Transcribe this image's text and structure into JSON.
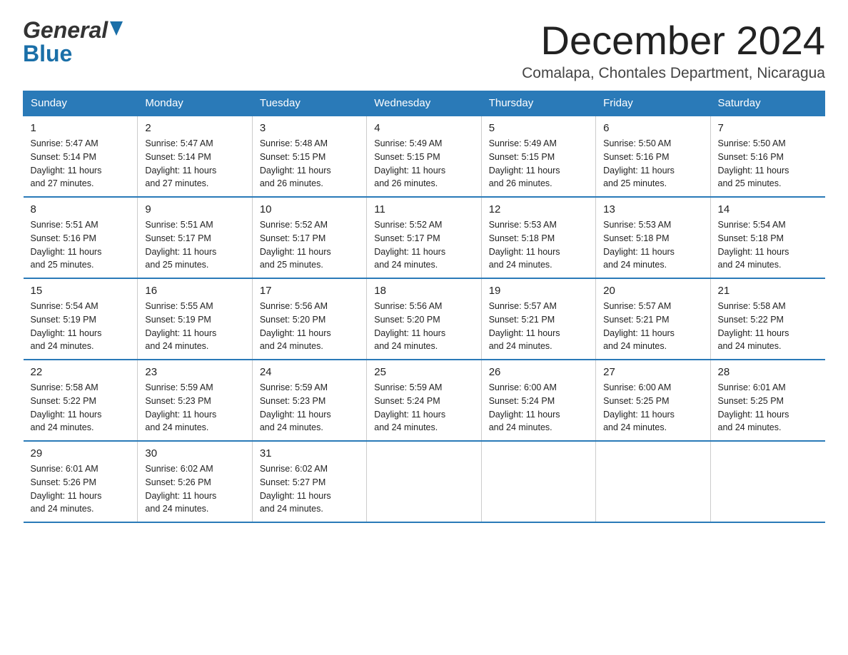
{
  "header": {
    "month_title": "December 2024",
    "location": "Comalapa, Chontales Department, Nicaragua",
    "logo_general": "General",
    "logo_blue": "Blue"
  },
  "weekdays": [
    "Sunday",
    "Monday",
    "Tuesday",
    "Wednesday",
    "Thursday",
    "Friday",
    "Saturday"
  ],
  "weeks": [
    [
      {
        "day": "1",
        "info": "Sunrise: 5:47 AM\nSunset: 5:14 PM\nDaylight: 11 hours\nand 27 minutes."
      },
      {
        "day": "2",
        "info": "Sunrise: 5:47 AM\nSunset: 5:14 PM\nDaylight: 11 hours\nand 27 minutes."
      },
      {
        "day": "3",
        "info": "Sunrise: 5:48 AM\nSunset: 5:15 PM\nDaylight: 11 hours\nand 26 minutes."
      },
      {
        "day": "4",
        "info": "Sunrise: 5:49 AM\nSunset: 5:15 PM\nDaylight: 11 hours\nand 26 minutes."
      },
      {
        "day": "5",
        "info": "Sunrise: 5:49 AM\nSunset: 5:15 PM\nDaylight: 11 hours\nand 26 minutes."
      },
      {
        "day": "6",
        "info": "Sunrise: 5:50 AM\nSunset: 5:16 PM\nDaylight: 11 hours\nand 25 minutes."
      },
      {
        "day": "7",
        "info": "Sunrise: 5:50 AM\nSunset: 5:16 PM\nDaylight: 11 hours\nand 25 minutes."
      }
    ],
    [
      {
        "day": "8",
        "info": "Sunrise: 5:51 AM\nSunset: 5:16 PM\nDaylight: 11 hours\nand 25 minutes."
      },
      {
        "day": "9",
        "info": "Sunrise: 5:51 AM\nSunset: 5:17 PM\nDaylight: 11 hours\nand 25 minutes."
      },
      {
        "day": "10",
        "info": "Sunrise: 5:52 AM\nSunset: 5:17 PM\nDaylight: 11 hours\nand 25 minutes."
      },
      {
        "day": "11",
        "info": "Sunrise: 5:52 AM\nSunset: 5:17 PM\nDaylight: 11 hours\nand 24 minutes."
      },
      {
        "day": "12",
        "info": "Sunrise: 5:53 AM\nSunset: 5:18 PM\nDaylight: 11 hours\nand 24 minutes."
      },
      {
        "day": "13",
        "info": "Sunrise: 5:53 AM\nSunset: 5:18 PM\nDaylight: 11 hours\nand 24 minutes."
      },
      {
        "day": "14",
        "info": "Sunrise: 5:54 AM\nSunset: 5:18 PM\nDaylight: 11 hours\nand 24 minutes."
      }
    ],
    [
      {
        "day": "15",
        "info": "Sunrise: 5:54 AM\nSunset: 5:19 PM\nDaylight: 11 hours\nand 24 minutes."
      },
      {
        "day": "16",
        "info": "Sunrise: 5:55 AM\nSunset: 5:19 PM\nDaylight: 11 hours\nand 24 minutes."
      },
      {
        "day": "17",
        "info": "Sunrise: 5:56 AM\nSunset: 5:20 PM\nDaylight: 11 hours\nand 24 minutes."
      },
      {
        "day": "18",
        "info": "Sunrise: 5:56 AM\nSunset: 5:20 PM\nDaylight: 11 hours\nand 24 minutes."
      },
      {
        "day": "19",
        "info": "Sunrise: 5:57 AM\nSunset: 5:21 PM\nDaylight: 11 hours\nand 24 minutes."
      },
      {
        "day": "20",
        "info": "Sunrise: 5:57 AM\nSunset: 5:21 PM\nDaylight: 11 hours\nand 24 minutes."
      },
      {
        "day": "21",
        "info": "Sunrise: 5:58 AM\nSunset: 5:22 PM\nDaylight: 11 hours\nand 24 minutes."
      }
    ],
    [
      {
        "day": "22",
        "info": "Sunrise: 5:58 AM\nSunset: 5:22 PM\nDaylight: 11 hours\nand 24 minutes."
      },
      {
        "day": "23",
        "info": "Sunrise: 5:59 AM\nSunset: 5:23 PM\nDaylight: 11 hours\nand 24 minutes."
      },
      {
        "day": "24",
        "info": "Sunrise: 5:59 AM\nSunset: 5:23 PM\nDaylight: 11 hours\nand 24 minutes."
      },
      {
        "day": "25",
        "info": "Sunrise: 5:59 AM\nSunset: 5:24 PM\nDaylight: 11 hours\nand 24 minutes."
      },
      {
        "day": "26",
        "info": "Sunrise: 6:00 AM\nSunset: 5:24 PM\nDaylight: 11 hours\nand 24 minutes."
      },
      {
        "day": "27",
        "info": "Sunrise: 6:00 AM\nSunset: 5:25 PM\nDaylight: 11 hours\nand 24 minutes."
      },
      {
        "day": "28",
        "info": "Sunrise: 6:01 AM\nSunset: 5:25 PM\nDaylight: 11 hours\nand 24 minutes."
      }
    ],
    [
      {
        "day": "29",
        "info": "Sunrise: 6:01 AM\nSunset: 5:26 PM\nDaylight: 11 hours\nand 24 minutes."
      },
      {
        "day": "30",
        "info": "Sunrise: 6:02 AM\nSunset: 5:26 PM\nDaylight: 11 hours\nand 24 minutes."
      },
      {
        "day": "31",
        "info": "Sunrise: 6:02 AM\nSunset: 5:27 PM\nDaylight: 11 hours\nand 24 minutes."
      },
      null,
      null,
      null,
      null
    ]
  ]
}
